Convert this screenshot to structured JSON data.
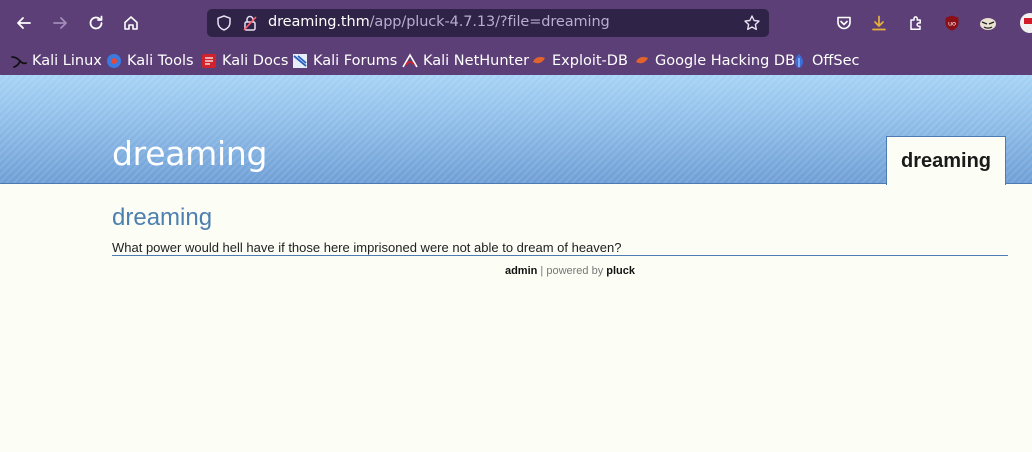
{
  "browser": {
    "url_host": "dreaming.thm",
    "url_path": "/app/pluck-4.7.13/?file=dreaming"
  },
  "bookmarks": [
    {
      "label": "Kali Linux",
      "icon": "kali-dragon-icon"
    },
    {
      "label": "Kali Tools",
      "icon": "kali-tools-icon"
    },
    {
      "label": "Kali Docs",
      "icon": "kali-docs-icon"
    },
    {
      "label": "Kali Forums",
      "icon": "kali-forums-icon"
    },
    {
      "label": "Kali NetHunter",
      "icon": "nethunter-icon"
    },
    {
      "label": "Exploit-DB",
      "icon": "exploit-db-icon"
    },
    {
      "label": "Google Hacking DB",
      "icon": "ghdb-icon"
    },
    {
      "label": "OffSec",
      "icon": "offsec-icon"
    }
  ],
  "site": {
    "title": "dreaming",
    "menu_item": "dreaming"
  },
  "content": {
    "heading": "dreaming",
    "text": "What power would hell have if those here imprisoned were not able to dream of heaven?"
  },
  "footer": {
    "admin_link": "admin",
    "separator": " | powered by ",
    "pluck_link": "pluck"
  },
  "colors": {
    "browser_bg": "#5c3f76",
    "urlbar_bg": "#2f2347",
    "header_top": "#a6d3f5",
    "header_bottom": "#6f9fd6",
    "heading": "#4d80b0",
    "page_bg": "#fcfdf5"
  }
}
